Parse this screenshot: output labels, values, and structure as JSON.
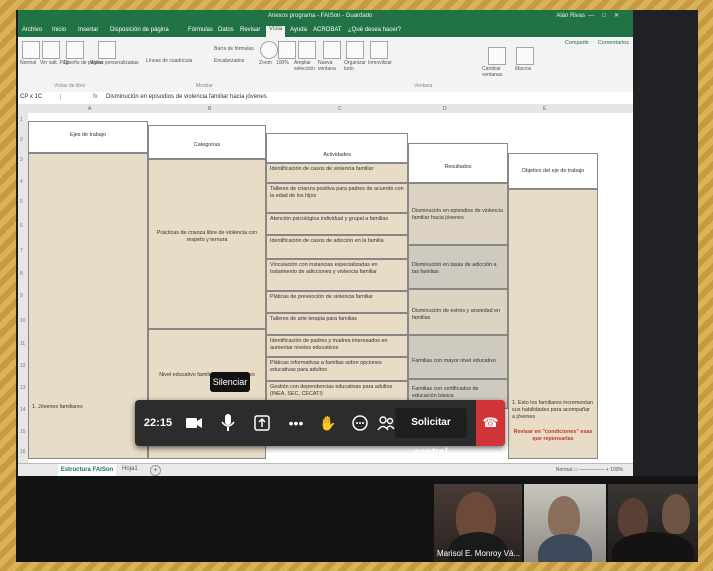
{
  "excel": {
    "doc_title": "Anexos programa - FAISon - Guardado",
    "user": "Alán Rivas",
    "window_controls": [
      "—",
      "□",
      "✕"
    ],
    "menu": [
      "Archivo",
      "Inicio",
      "Insertar",
      "Disposición de página",
      "Fórmulas",
      "Datos",
      "Revisar",
      "Vista",
      "Ayuda",
      "ACROBAT",
      "¿Qué desea hacer?"
    ],
    "active_menu": "Vista",
    "ribbon": {
      "normal": "Normal",
      "page_break": "Ver salt. Pág.",
      "page_layout": "Diseño de página",
      "custom_views": "Vistas personalizadas",
      "group_views": "Vistas de libro",
      "gridlines": "Líneas de cuadrícula",
      "formula_bar": "Barra de fórmulas",
      "headings": "Encabezados",
      "group_show": "Mostrar",
      "zoom": "Zoom",
      "zoom100": "100%",
      "zoom_sel": "Ampliar selección",
      "new_window": "Nueva ventana",
      "arrange": "Organizar todo",
      "freeze": "Inmovilizar",
      "group_window": "Ventana",
      "macros": "Macros",
      "switch": "Cambiar ventanas",
      "share": "Compartir",
      "comments": "Comentarios"
    },
    "cell_ref": "CP x 1C",
    "fx": "fx",
    "formula_text": "Disminución en episodios de violencia familiar hacia jóvenes",
    "columns": [
      "A",
      "B",
      "C",
      "D",
      "E"
    ],
    "rows": [
      "1",
      "2",
      "3",
      "4",
      "5",
      "6",
      "7",
      "8",
      "9",
      "10",
      "11",
      "12",
      "13",
      "14",
      "15",
      "16",
      "17",
      "18"
    ],
    "headers": {
      "ejes": "Ejes de trabajo",
      "categorias": "Categorías",
      "actividades": "Actividades",
      "resultados": "Resultados",
      "objetivo": "Objetivo del eje de trabajo"
    },
    "eje_value": "1. Jóvenes familiares",
    "cat1": "Prácticas de crianza libre de violencia con respeto y ternura",
    "cat2": "Nivel educativo familiar y de los jóvenes",
    "activities": [
      "Identificación de casos de violencia familiar",
      "Talleres de crianza positiva para padres de acuerdo con la edad de los hijos",
      "Atención psicológica individual y grupal a familias",
      "Identificación de casos de adicción en la familia",
      "Vinculación con instancias especializadas en tratamiento de adicciones y violencia familiar",
      "Pláticas de prevención de violencia familiar",
      "Talleres de arte terapia para familias",
      "Identificación de padres y madres interesados en aumentar niveles educativos",
      "Pláticas informativas a familias sobre opciones educativas para adultos",
      "Gestión con dependencias educativas para adultos (INEA, SEC, CECATI)"
    ],
    "results": [
      "Disminución en episodios de violencia familiar hacia jóvenes",
      "Disminución en tasas de adicción a las familias",
      "Disminución de estrés y ansiedad en familias",
      "Familias con mayor nivel educativo",
      "Familias con certificados de educación básica"
    ],
    "objective": "1. Esto los familiares incrementan sus habilidades para acompañar a jóvenes",
    "objective_red": "Revisar en \"condiciones\" esas que repensarlas",
    "sheet_tab": "Estructura FAISon",
    "sheet_tab2": "Hoja1",
    "add_sheet": "+",
    "status_zoom": "Normal  ▭  —————  + 100%"
  },
  "meeting": {
    "time": "22:15",
    "tooltip": "Silenciar",
    "control_label": "Solicitar control",
    "buttons": [
      "camera-icon",
      "mic-icon",
      "share-icon",
      "more-icon",
      "raise-hand-icon",
      "chat-icon",
      "participants-icon"
    ],
    "participant_name": "Marisol E. Monroy Vá..."
  }
}
